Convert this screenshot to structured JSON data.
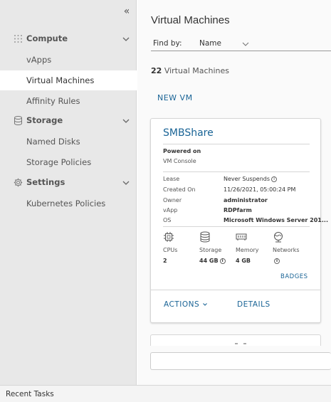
{
  "sidebar": {
    "collapse_icon": "double-chevron-left-icon",
    "groups": [
      {
        "label": "Compute",
        "icon": "grid-icon",
        "items": [
          "vApps",
          "Virtual Machines",
          "Affinity Rules"
        ]
      },
      {
        "label": "Storage",
        "icon": "database-icon",
        "items": [
          "Named Disks",
          "Storage Policies"
        ]
      },
      {
        "label": "Settings",
        "icon": "gear-icon",
        "items": [
          "Kubernetes Policies"
        ]
      }
    ],
    "active_item": "Virtual Machines"
  },
  "main": {
    "title": "Virtual Machines",
    "find_by": {
      "label": "Find by:",
      "value": "Name"
    },
    "count": {
      "number": "22",
      "text": "Virtual Machines"
    },
    "new_vm_label": "NEW VM"
  },
  "vm_card": {
    "name": "SMBShare",
    "power_state": "Powered on",
    "console_link": "VM Console",
    "properties": [
      {
        "label": "Lease",
        "value": "Never Suspends",
        "info": true
      },
      {
        "label": "Created On",
        "value": "11/26/2021, 05:00:24 PM"
      },
      {
        "label": "Owner",
        "value": "administrator"
      },
      {
        "label": "vApp",
        "value": "RDPfarm"
      },
      {
        "label": "OS",
        "value": "Microsoft Windows Server 201..."
      }
    ],
    "resources": [
      {
        "label": "CPUs",
        "value": "2",
        "icon": "cpu-icon"
      },
      {
        "label": "Storage",
        "value": "44 GB",
        "icon": "storage-icon",
        "info": true
      },
      {
        "label": "Memory",
        "value": "4 GB",
        "icon": "memory-icon"
      },
      {
        "label": "Networks",
        "value": "",
        "icon": "network-icon",
        "info": true
      }
    ],
    "badges_label": "BADGES",
    "actions_label": "ACTIONS",
    "details_label": "DETAILS"
  },
  "bottom_bar": {
    "recent_tasks": "Recent Tasks"
  },
  "colors": {
    "link": "#1a6496",
    "sidebar_bg": "#e8e8e8",
    "main_bg": "#fafafa"
  }
}
